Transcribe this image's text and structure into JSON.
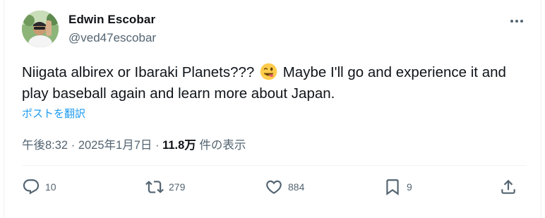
{
  "author": {
    "name": "Edwin Escobar",
    "handle": "@ved47escobar"
  },
  "tweet": {
    "text_part1": "Niigata albirex or Ibaraki Planets???",
    "emoji": "winking-face-with-tongue",
    "text_part2": "Maybe I'll go and experience it and play baseball again and learn more about Japan.",
    "translate_label": "ポストを翻訳",
    "time": "午後8:32",
    "date": "2025年1月7日",
    "separator": "·",
    "views_count": "11.8万",
    "views_label": "件の表示"
  },
  "actions": {
    "replies": "10",
    "retweets": "279",
    "likes": "884",
    "bookmarks": "9"
  },
  "colors": {
    "accent": "#1d9bf0",
    "secondary_text": "#536471",
    "primary_text": "#0f1419"
  }
}
